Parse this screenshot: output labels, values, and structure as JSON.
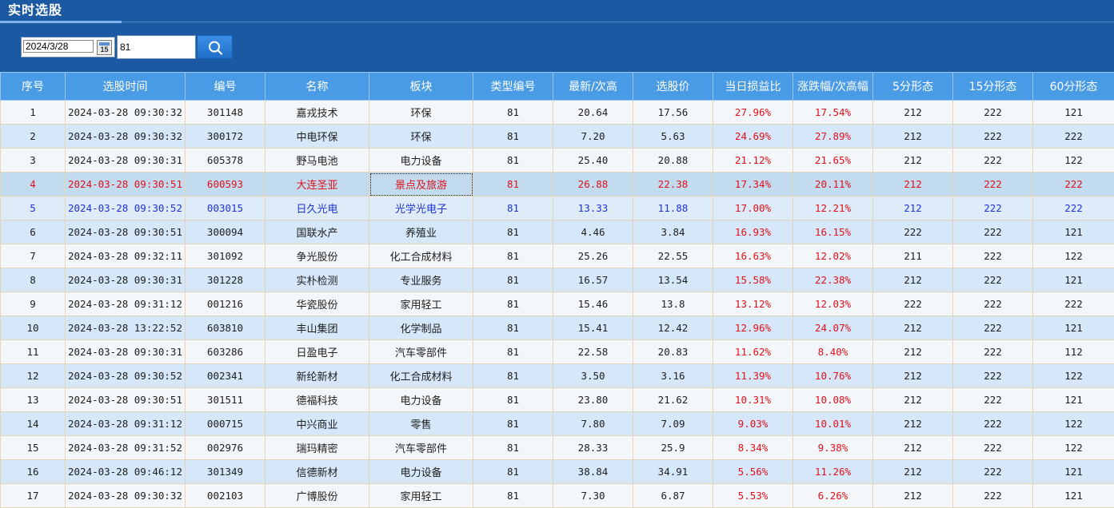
{
  "window": {
    "title": "实时选股"
  },
  "filters": {
    "date": "2024/3/28",
    "calendar_label": "15",
    "code": "81"
  },
  "colors": {
    "header_bg": "#1b5aa2",
    "table_header": "#4a9be6",
    "up_red": "#e0101a",
    "selected_blue": "#1f33d8"
  },
  "table": {
    "columns": [
      "序号",
      "选股时间",
      "编号",
      "名称",
      "板块",
      "类型编号",
      "最新/次高",
      "选股价",
      "当日损益比",
      "涨跌幅/次高幅",
      "5分形态",
      "15分形态",
      "60分形态"
    ],
    "rows": [
      [
        "1",
        "2024-03-28 09:30:32",
        "301148",
        "嘉戎技术",
        "环保",
        "81",
        "20.64",
        "17.56",
        "27.96%",
        "17.54%",
        "212",
        "222",
        "121"
      ],
      [
        "2",
        "2024-03-28 09:30:32",
        "300172",
        "中电环保",
        "环保",
        "81",
        "7.20",
        "5.63",
        "24.69%",
        "27.89%",
        "212",
        "222",
        "222"
      ],
      [
        "3",
        "2024-03-28 09:30:31",
        "605378",
        "野马电池",
        "电力设备",
        "81",
        "25.40",
        "20.88",
        "21.12%",
        "21.65%",
        "212",
        "222",
        "122"
      ],
      [
        "4",
        "2024-03-28 09:30:51",
        "600593",
        "大连圣亚",
        "景点及旅游",
        "81",
        "26.88",
        "22.38",
        "17.34%",
        "20.11%",
        "212",
        "222",
        "222"
      ],
      [
        "5",
        "2024-03-28 09:30:52",
        "003015",
        "日久光电",
        "光学光电子",
        "81",
        "13.33",
        "11.88",
        "17.00%",
        "12.21%",
        "212",
        "222",
        "222"
      ],
      [
        "6",
        "2024-03-28 09:30:51",
        "300094",
        "国联水产",
        "养殖业",
        "81",
        "4.46",
        "3.84",
        "16.93%",
        "16.15%",
        "222",
        "222",
        "121"
      ],
      [
        "7",
        "2024-03-28 09:32:11",
        "301092",
        "争光股份",
        "化工合成材料",
        "81",
        "25.26",
        "22.55",
        "16.63%",
        "12.02%",
        "211",
        "222",
        "122"
      ],
      [
        "8",
        "2024-03-28 09:30:31",
        "301228",
        "实朴检测",
        "专业服务",
        "81",
        "16.57",
        "13.54",
        "15.58%",
        "22.38%",
        "212",
        "222",
        "121"
      ],
      [
        "9",
        "2024-03-28 09:31:12",
        "001216",
        "华瓷股份",
        "家用轻工",
        "81",
        "15.46",
        "13.8",
        "13.12%",
        "12.03%",
        "222",
        "222",
        "222"
      ],
      [
        "10",
        "2024-03-28 13:22:52",
        "603810",
        "丰山集团",
        "化学制品",
        "81",
        "15.41",
        "12.42",
        "12.96%",
        "24.07%",
        "212",
        "222",
        "121"
      ],
      [
        "11",
        "2024-03-28 09:30:31",
        "603286",
        "日盈电子",
        "汽车零部件",
        "81",
        "22.58",
        "20.83",
        "11.62%",
        "8.40%",
        "212",
        "222",
        "112"
      ],
      [
        "12",
        "2024-03-28 09:30:52",
        "002341",
        "新纶新材",
        "化工合成材料",
        "81",
        "3.50",
        "3.16",
        "11.39%",
        "10.76%",
        "212",
        "222",
        "122"
      ],
      [
        "13",
        "2024-03-28 09:30:51",
        "301511",
        "德福科技",
        "电力设备",
        "81",
        "23.80",
        "21.62",
        "10.31%",
        "10.08%",
        "212",
        "222",
        "121"
      ],
      [
        "14",
        "2024-03-28 09:31:12",
        "000715",
        "中兴商业",
        "零售",
        "81",
        "7.80",
        "7.09",
        "9.03%",
        "10.01%",
        "212",
        "222",
        "122"
      ],
      [
        "15",
        "2024-03-28 09:31:52",
        "002976",
        "瑞玛精密",
        "汽车零部件",
        "81",
        "28.33",
        "25.9",
        "8.34%",
        "9.38%",
        "212",
        "222",
        "122"
      ],
      [
        "16",
        "2024-03-28 09:46:12",
        "301349",
        "信德新材",
        "电力设备",
        "81",
        "38.84",
        "34.91",
        "5.56%",
        "11.26%",
        "212",
        "222",
        "121"
      ],
      [
        "17",
        "2024-03-28 09:30:32",
        "002103",
        "广博股份",
        "家用轻工",
        "81",
        "7.30",
        "6.87",
        "5.53%",
        "6.26%",
        "212",
        "222",
        "121"
      ]
    ]
  }
}
